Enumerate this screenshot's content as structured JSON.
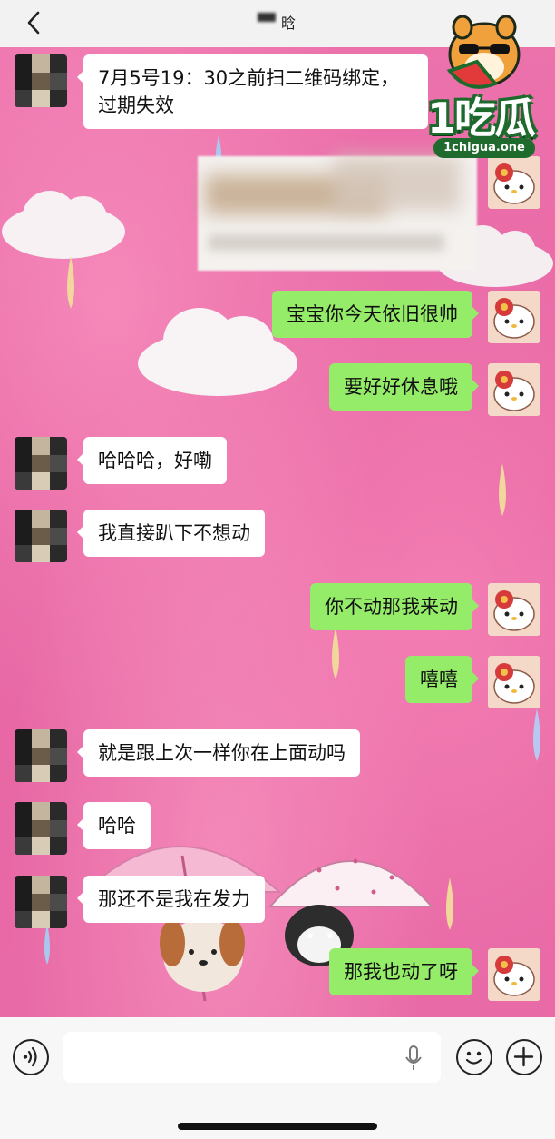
{
  "header": {
    "title": "晗"
  },
  "watermark": {
    "logo_text": "1吃瓜",
    "url": "1chigua.one"
  },
  "messages": [
    {
      "side": "left",
      "text_line1": "7月5号19：30之前扫二维码绑定，",
      "text_line2": "过期失效"
    },
    {
      "side": "right",
      "text": "宝宝你今天依旧很帅"
    },
    {
      "side": "right",
      "text": "要好好休息哦"
    },
    {
      "side": "left",
      "text": "哈哈哈，好嘞"
    },
    {
      "side": "left",
      "text": "我直接趴下不想动"
    },
    {
      "side": "right",
      "text": "你不动那我来动"
    },
    {
      "side": "right",
      "text": "嘻嘻"
    },
    {
      "side": "left",
      "text": "就是跟上次一样你在上面动吗"
    },
    {
      "side": "left",
      "text": "哈哈"
    },
    {
      "side": "left",
      "text": "那还不是我在发力"
    },
    {
      "side": "right",
      "text": "那我也动了呀"
    }
  ],
  "input": {
    "value": "",
    "placeholder": ""
  },
  "icons": {
    "back": "chevron-left-icon",
    "voice": "voice-icon",
    "mic": "microphone-icon",
    "emoji": "emoji-icon",
    "plus": "plus-icon"
  },
  "colors": {
    "sent_bubble": "#95ec69",
    "received_bubble": "#ffffff",
    "wallpaper": "#e86aa6"
  }
}
